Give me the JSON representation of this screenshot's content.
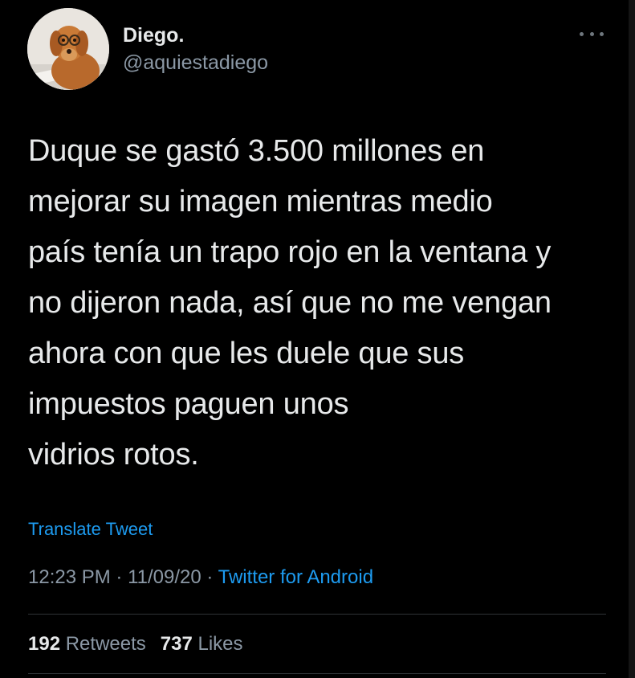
{
  "author": {
    "display_name": "Diego.",
    "handle": "@aquiestadiego",
    "avatar_icon": "dog-with-glasses-avatar"
  },
  "more_icon": "more-horizontal-icon",
  "tweet": {
    "lines": [
      "Duque se gastó 3.500 millones en",
      "mejorar su imagen mientras medio",
      "país tenía un trapo rojo en la ventana y",
      "no dijeron nada, así que no me vengan",
      "ahora con que les duele que sus",
      "impuestos paguen unos",
      "vidrios rotos."
    ]
  },
  "translate_label": "Translate Tweet",
  "meta": {
    "time": "12:23 PM",
    "separator": "·",
    "date": "11/09/20",
    "source": "Twitter for Android"
  },
  "stats": {
    "retweets_count": "192",
    "retweets_label": "Retweets",
    "likes_count": "737",
    "likes_label": "Likes"
  },
  "colors": {
    "background": "#000000",
    "text": "#e7e9ea",
    "secondary": "#8b98a5",
    "link": "#1d9bf0",
    "divider": "#2f3336"
  }
}
